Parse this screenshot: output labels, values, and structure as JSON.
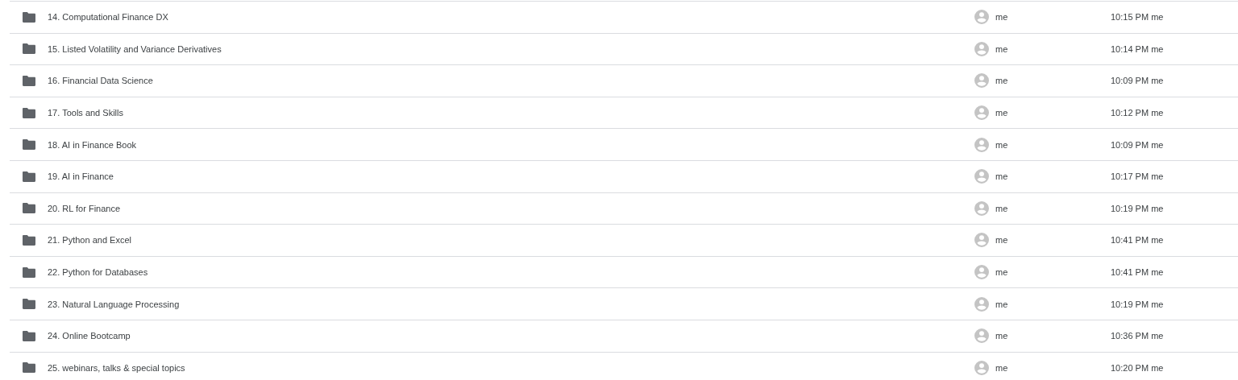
{
  "files": [
    {
      "name": "14. Computational Finance DX",
      "owner": "me",
      "modified": "10:15 PM me"
    },
    {
      "name": "15. Listed Volatility and Variance Derivatives",
      "owner": "me",
      "modified": "10:14 PM me"
    },
    {
      "name": "16. Financial Data Science",
      "owner": "me",
      "modified": "10:09 PM me"
    },
    {
      "name": "17. Tools and Skills",
      "owner": "me",
      "modified": "10:12 PM me"
    },
    {
      "name": "18. AI in Finance Book",
      "owner": "me",
      "modified": "10:09 PM me"
    },
    {
      "name": "19. AI in Finance",
      "owner": "me",
      "modified": "10:17 PM me"
    },
    {
      "name": "20. RL for Finance",
      "owner": "me",
      "modified": "10:19 PM me"
    },
    {
      "name": "21. Python and Excel",
      "owner": "me",
      "modified": "10:41 PM me"
    },
    {
      "name": "22. Python for Databases",
      "owner": "me",
      "modified": "10:41 PM me"
    },
    {
      "name": "23. Natural Language Processing",
      "owner": "me",
      "modified": "10:19 PM me"
    },
    {
      "name": "24. Online Bootcamp",
      "owner": "me",
      "modified": "10:36 PM me"
    },
    {
      "name": "25. webinars, talks & special topics",
      "owner": "me",
      "modified": "10:20 PM me"
    }
  ]
}
